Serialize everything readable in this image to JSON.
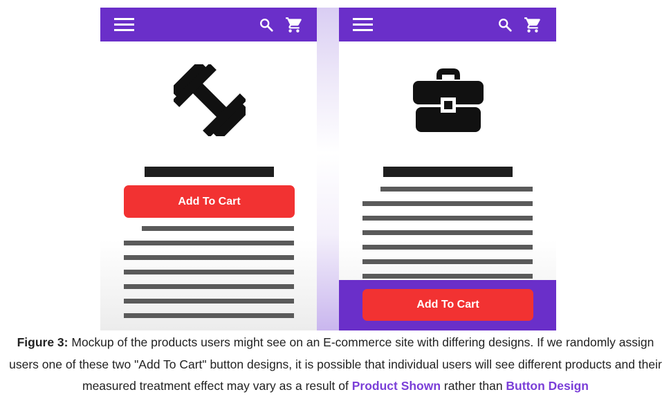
{
  "mockups": [
    {
      "product_icon": "dumbbell-icon",
      "button_label": "Add To Cart",
      "button_placement": "below-title"
    },
    {
      "product_icon": "briefcase-icon",
      "button_label": "Add To Cart",
      "button_placement": "bottom-bar"
    }
  ],
  "app_bar_icons": [
    "menu-icon",
    "search-icon",
    "cart-icon"
  ],
  "caption": {
    "label": "Figure 3:",
    "text": " Mockup of the products users might see on an E-commerce site with differing designs. If we randomly assign users one of these two \"Add To Cart\" button designs, it is possible that individual users will see different products and their measured treatment effect may vary as a result of ",
    "highlight_1": "Product Shown",
    "middle": " rather than ",
    "highlight_2": "Button Design"
  },
  "colors": {
    "app_bar": "#6a2fc9",
    "button": "#f23232",
    "highlight_text": "#7b3fd8",
    "text_lines": "#5a5a5a",
    "title_bar": "#1e1e1e"
  }
}
